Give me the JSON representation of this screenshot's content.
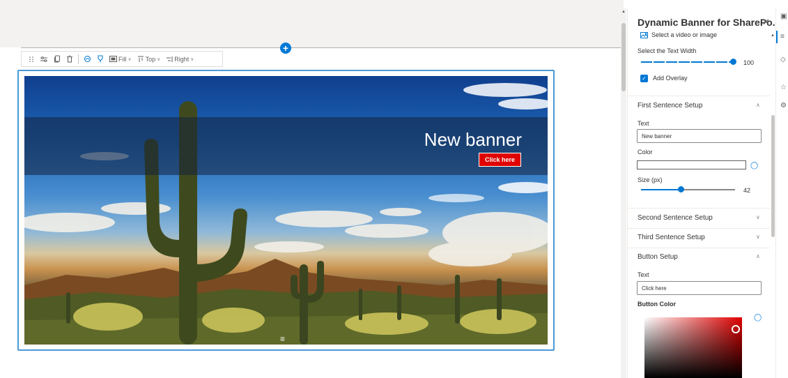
{
  "toolbar": {
    "fill_label": "Fill",
    "top_label": "Top",
    "right_label": "Right"
  },
  "banner": {
    "title": "New banner",
    "button_label": "Click here",
    "button_color": "#e00000",
    "overlay": true
  },
  "pane": {
    "title": "Dynamic Banner for SharePo...",
    "select_media_link": "Select a video or image",
    "text_width_label": "Select the Text Width",
    "text_width_value": "100",
    "add_overlay_label": "Add Overlay",
    "add_overlay_checked": true,
    "first_sentence": {
      "header": "First Sentence Setup",
      "text_label": "Text",
      "text_value": "New banner",
      "color_label": "Color",
      "size_label": "Size (px)",
      "size_value": "42",
      "size_fraction": 0.42
    },
    "second_sentence_header": "Second Sentence Setup",
    "third_sentence_header": "Third Sentence Setup",
    "button_setup": {
      "header": "Button Setup",
      "text_label": "Text",
      "text_value": "Click here",
      "button_color_label": "Button Color"
    }
  },
  "colors": {
    "accent": "#0078d4",
    "selection_frame": "#4a9ad8"
  }
}
